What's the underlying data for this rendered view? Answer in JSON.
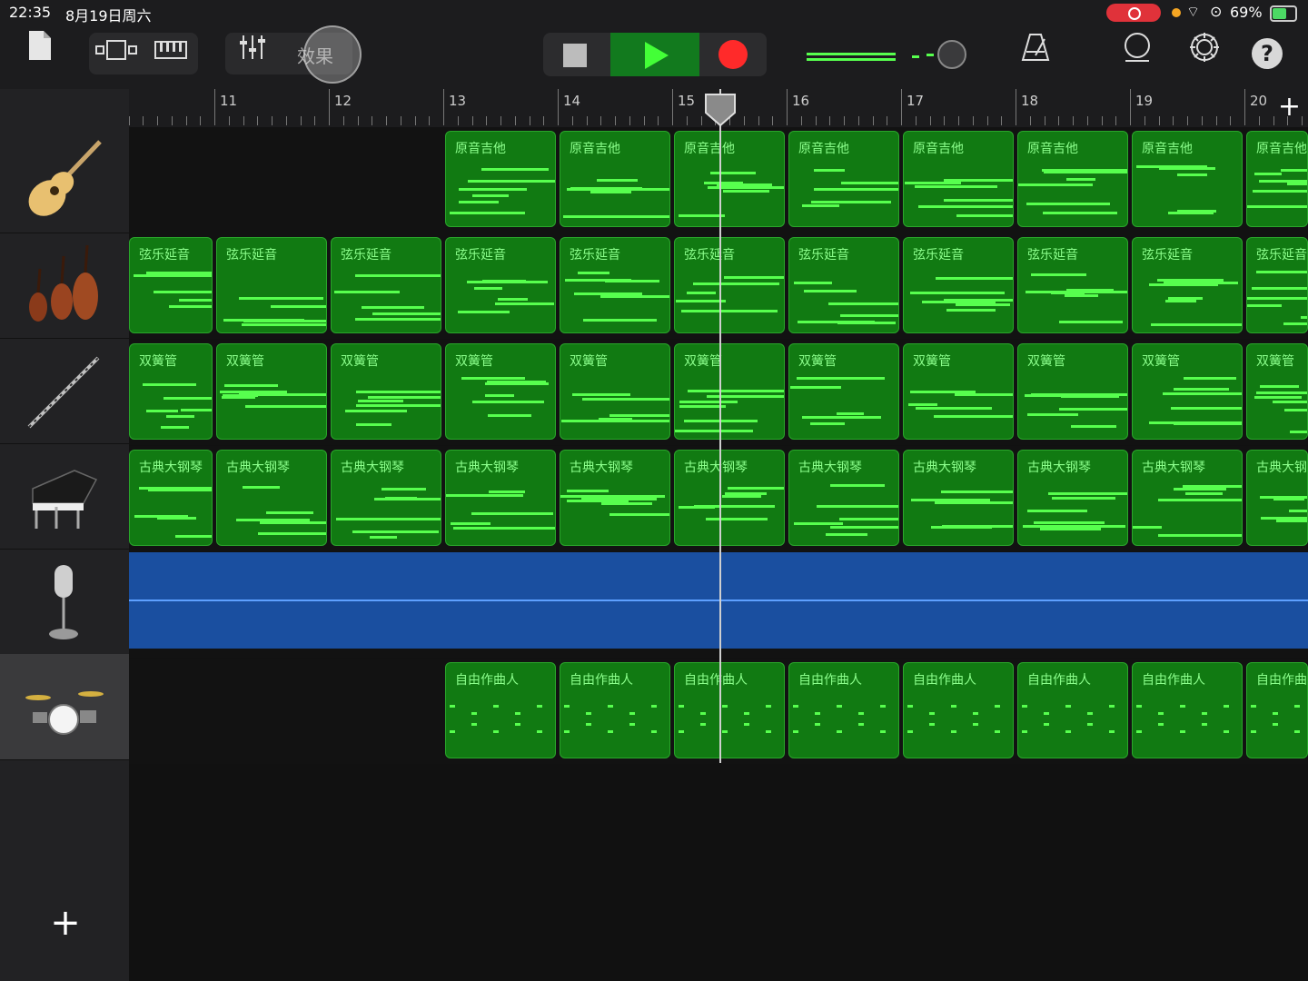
{
  "status": {
    "time": "22:35",
    "date": "8月19日周六",
    "battery": "69%"
  },
  "toolbar": {
    "fx_label": "效果"
  },
  "ruler": {
    "bars": [
      "11",
      "12",
      "13",
      "14",
      "15",
      "16",
      "17",
      "18",
      "19",
      "20"
    ]
  },
  "tracks": [
    {
      "instrument": "acoustic-guitar",
      "region_label": "原音吉他"
    },
    {
      "instrument": "strings",
      "region_label": "弦乐延音"
    },
    {
      "instrument": "oboe",
      "region_label": "双簧管"
    },
    {
      "instrument": "grand-piano",
      "region_label": "古典大钢琴"
    },
    {
      "instrument": "microphone",
      "region_label": ""
    },
    {
      "instrument": "drum-kit",
      "region_label": "自由作曲人"
    }
  ],
  "colors": {
    "region": "#117a12",
    "note": "#57ff4e",
    "audio": "#1a4fa0",
    "play": "#43ff37",
    "record": "#ff2a2a"
  },
  "playhead_bar": 15.3
}
